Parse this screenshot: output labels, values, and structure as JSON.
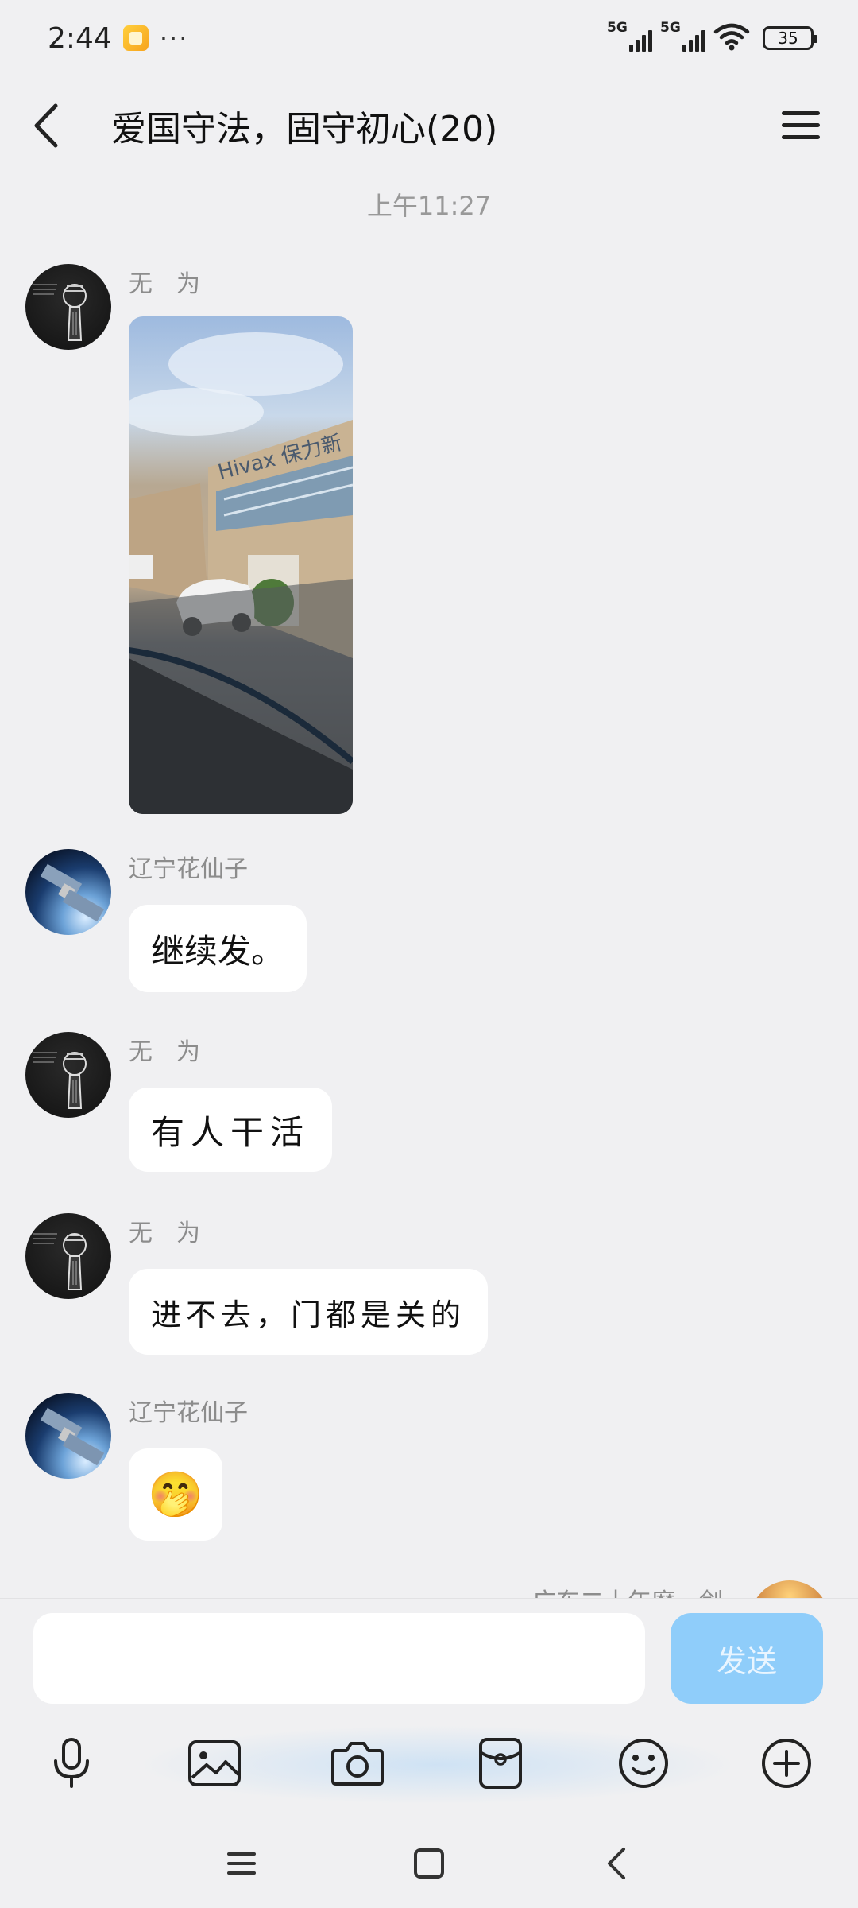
{
  "status_bar": {
    "time": "2:44",
    "more": "···",
    "network_1": "5G",
    "network_2": "5G",
    "battery": "35"
  },
  "header": {
    "title": "爱国守法，固守初心(20)"
  },
  "chat": {
    "timestamp": "上午11:27",
    "messages": [
      {
        "sender": "无　为",
        "type": "image"
      },
      {
        "sender": "辽宁花仙子",
        "text": "继续发。"
      },
      {
        "sender": "无　为",
        "text": "有人干活"
      },
      {
        "sender": "无　为",
        "text": "进不去，门都是关的"
      },
      {
        "sender": "辽宁花仙子",
        "text": "🤭"
      },
      {
        "sender": "广东二十年磨一剑"
      }
    ]
  },
  "input": {
    "placeholder": "",
    "send_label": "发送"
  },
  "toolbar": {
    "items": [
      "microphone-icon",
      "image-icon",
      "camera-icon",
      "red-packet-icon",
      "emoji-icon",
      "plus-icon"
    ]
  },
  "colors": {
    "background": "#f0f0f2",
    "send_button": "#8fcdfa",
    "bubble": "#ffffff"
  }
}
